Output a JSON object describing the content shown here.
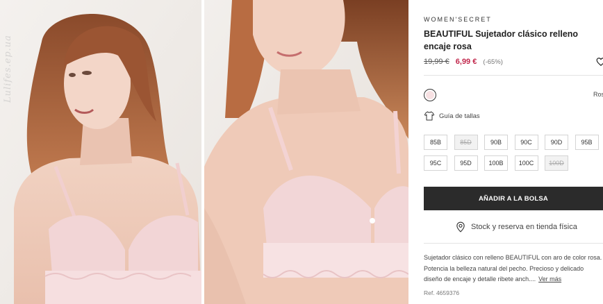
{
  "gallery": {
    "watermark": "Lulifes.ep.ua"
  },
  "product": {
    "brand": "WOMEN'SECRET",
    "title": "BEAUTIFUL Sujetador clásico relleno encaje rosa",
    "old_price": "19,99 €",
    "new_price": "6,99 €",
    "discount": "(-65%)",
    "wishlist_icon": "heart-icon"
  },
  "color": {
    "name": "Rosa",
    "swatch_hex": "#f7e1e3"
  },
  "size_guide": {
    "label": "Guía de tallas",
    "icon": "shirt-icon"
  },
  "sizes": [
    {
      "label": "85B",
      "available": true
    },
    {
      "label": "85D",
      "available": false
    },
    {
      "label": "90B",
      "available": true
    },
    {
      "label": "90C",
      "available": true
    },
    {
      "label": "90D",
      "available": true
    },
    {
      "label": "95B",
      "available": true
    },
    {
      "label": "95C",
      "available": true
    },
    {
      "label": "95D",
      "available": true
    },
    {
      "label": "100B",
      "available": true
    },
    {
      "label": "100C",
      "available": true
    },
    {
      "label": "100D",
      "available": false
    }
  ],
  "actions": {
    "add_to_bag": "AÑADIR A LA BOLSA",
    "stock": "Stock y reserva en tienda física",
    "stock_icon": "location-pin-icon"
  },
  "description": {
    "text": "Sujetador clásico con relleno BEAUTIFUL con aro de color rosa. Potencia la belleza natural del pecho. Precioso y delicado diseño de encaje y detalle ribete anch....",
    "see_more": "Ver más",
    "ref": "Ref. 4659376"
  },
  "colors": {
    "accent_price": "#c1264b",
    "button_bg": "#2b2b2b"
  }
}
